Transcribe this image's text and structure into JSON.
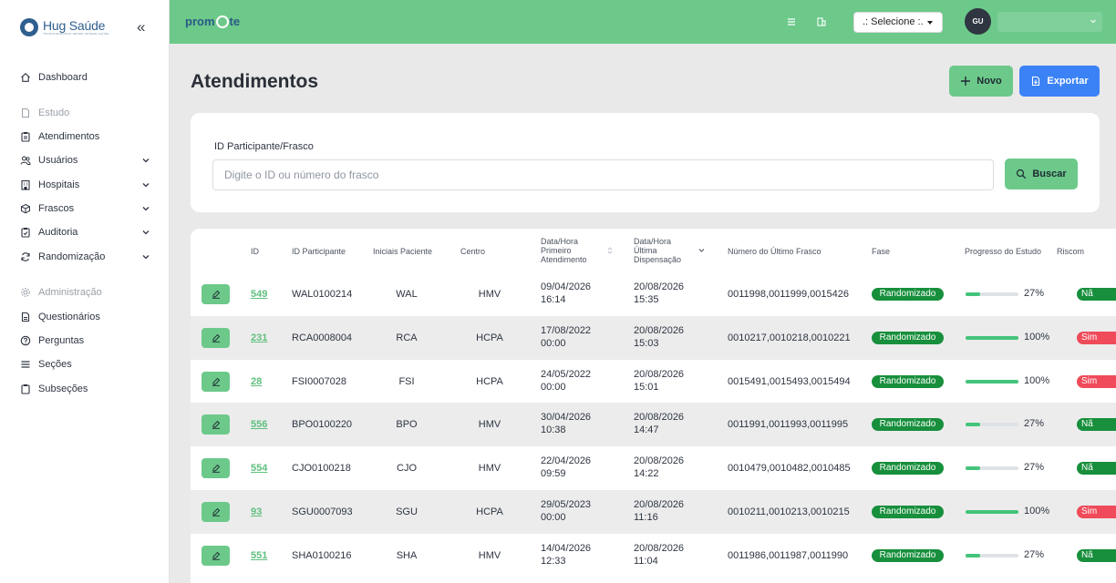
{
  "sidebar": {
    "brand_name": "Hug Saúde",
    "brand_tag": "TRANSFORMANDO DESDE ORIGEM SAÚDE",
    "collapse_label": "«",
    "items": [
      {
        "label": "Dashboard",
        "icon": "home-icon"
      },
      {
        "label": "Estudo",
        "icon": "document-icon",
        "section": true
      },
      {
        "label": "Atendimentos",
        "icon": "clipboard-icon"
      },
      {
        "label": "Usuários",
        "icon": "users-icon",
        "expandable": true
      },
      {
        "label": "Hospitais",
        "icon": "building-icon",
        "expandable": true
      },
      {
        "label": "Frascos",
        "icon": "box-icon",
        "expandable": true
      },
      {
        "label": "Auditoria",
        "icon": "clipboard-check-icon",
        "expandable": true
      },
      {
        "label": "Randomização",
        "icon": "shuffle-icon",
        "expandable": true
      },
      {
        "label": "Administração",
        "icon": "gear-icon",
        "section": true
      },
      {
        "label": "Questionários",
        "icon": "file-icon"
      },
      {
        "label": "Perguntas",
        "icon": "question-icon"
      },
      {
        "label": "Seções",
        "icon": "menu-icon"
      },
      {
        "label": "Subseções",
        "icon": "clipboard-icon"
      }
    ]
  },
  "topbar": {
    "logo": "prom",
    "logo_suffix": "te",
    "select_label": ".: Selecione :.",
    "avatar_initials": "GU",
    "color": "#6cc98a"
  },
  "page": {
    "title": "Atendimentos",
    "new_label": "Novo",
    "export_label": "Exportar"
  },
  "search": {
    "label": "ID Participante/Frasco",
    "placeholder": "Digite o ID ou número do frasco",
    "button_label": "Buscar"
  },
  "table": {
    "headers": {
      "id": "ID",
      "participant": "ID Participante",
      "initials": "Iniciais Paciente",
      "center": "Centro",
      "first": "Data/Hora\nPrimeiro\nAtendimento",
      "last": "Data/Hora\nÚltima\nDispensação",
      "vials": "Número do Último Frasco",
      "phase": "Fase",
      "progress": "Progresso do Estudo",
      "risk": "Riscom"
    },
    "rows": [
      {
        "id": "549",
        "participant": "WAL0100214",
        "initials": "WAL",
        "center": "HMV",
        "first_date": "09/04/2026",
        "first_time": "16:14",
        "last_date": "20/08/2026",
        "last_time": "15:35",
        "vials": "0011998,0011999,0015426",
        "phase": "Randomizado",
        "progress": 27,
        "progress_label": "27%",
        "risk": "Nã"
      },
      {
        "id": "231",
        "participant": "RCA0008004",
        "initials": "RCA",
        "center": "HCPA",
        "first_date": "17/08/2022",
        "first_time": "00:00",
        "last_date": "20/08/2026",
        "last_time": "15:03",
        "vials": "0010217,0010218,0010221",
        "phase": "Randomizado",
        "progress": 100,
        "progress_label": "100%",
        "risk": "Sim"
      },
      {
        "id": "28",
        "participant": "FSI0007028",
        "initials": "FSI",
        "center": "HCPA",
        "first_date": "24/05/2022",
        "first_time": "00:00",
        "last_date": "20/08/2026",
        "last_time": "15:01",
        "vials": "0015491,0015493,0015494",
        "phase": "Randomizado",
        "progress": 100,
        "progress_label": "100%",
        "risk": "Sim"
      },
      {
        "id": "556",
        "participant": "BPO0100220",
        "initials": "BPO",
        "center": "HMV",
        "first_date": "30/04/2026",
        "first_time": "10:38",
        "last_date": "20/08/2026",
        "last_time": "14:47",
        "vials": "0011991,0011993,0011995",
        "phase": "Randomizado",
        "progress": 27,
        "progress_label": "27%",
        "risk": "Nã"
      },
      {
        "id": "554",
        "participant": "CJO0100218",
        "initials": "CJO",
        "center": "HMV",
        "first_date": "22/04/2026",
        "first_time": "09:59",
        "last_date": "20/08/2026",
        "last_time": "14:22",
        "vials": "0010479,0010482,0010485",
        "phase": "Randomizado",
        "progress": 27,
        "progress_label": "27%",
        "risk": "Nã"
      },
      {
        "id": "93",
        "participant": "SGU0007093",
        "initials": "SGU",
        "center": "HCPA",
        "first_date": "29/05/2023",
        "first_time": "00:00",
        "last_date": "20/08/2026",
        "last_time": "11:16",
        "vials": "0010211,0010213,0010215",
        "phase": "Randomizado",
        "progress": 100,
        "progress_label": "100%",
        "risk": "Sim"
      },
      {
        "id": "551",
        "participant": "SHA0100216",
        "initials": "SHA",
        "center": "HMV",
        "first_date": "14/04/2026",
        "first_time": "12:33",
        "last_date": "20/08/2026",
        "last_time": "11:04",
        "vials": "0011986,0011987,0011990",
        "phase": "Randomizado",
        "progress": 27,
        "progress_label": "27%",
        "risk": "Nã"
      }
    ]
  }
}
